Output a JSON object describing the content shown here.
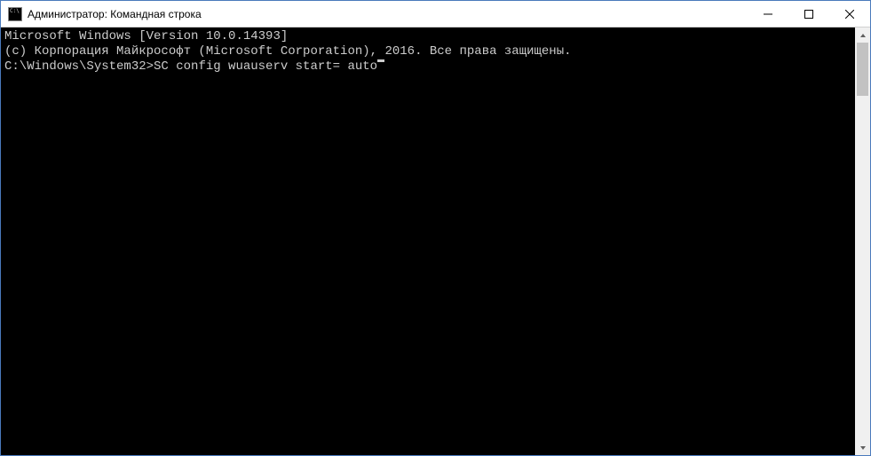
{
  "window": {
    "title": "Администратор: Командная строка"
  },
  "terminal": {
    "line1": "Microsoft Windows [Version 10.0.14393]",
    "line2": "(c) Корпорация Майкрософт (Microsoft Corporation), 2016. Все права защищены.",
    "blank": "",
    "prompt": "C:\\Windows\\System32>",
    "command": "SC config wuauserv start= auto"
  }
}
